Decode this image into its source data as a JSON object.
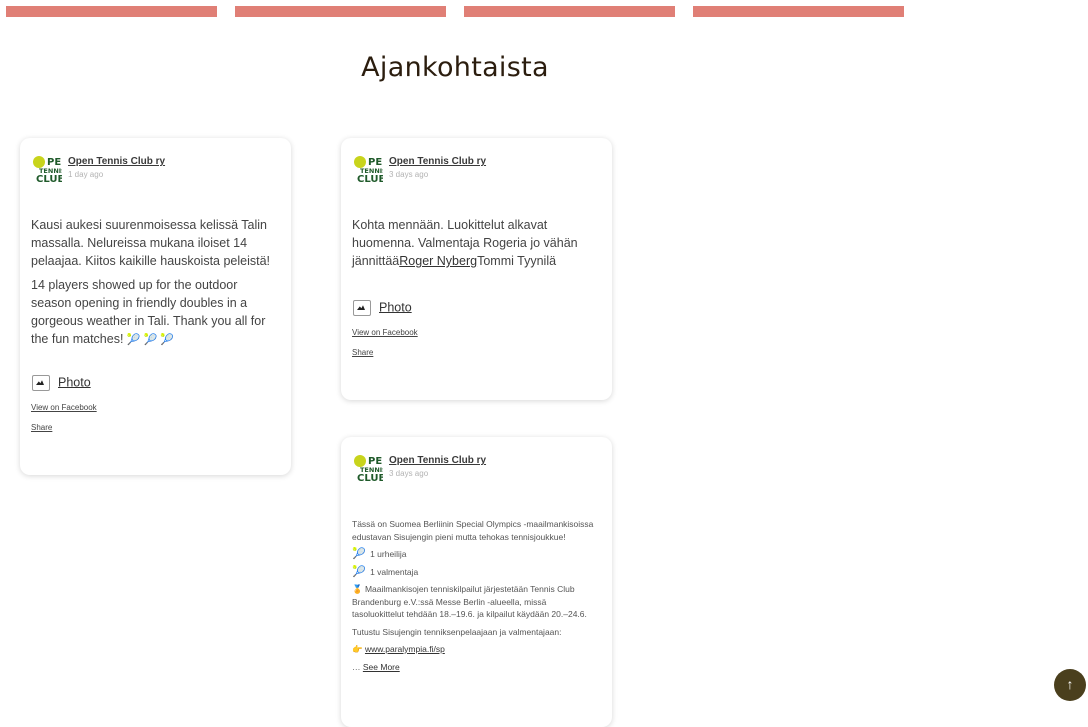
{
  "nav": {
    "items": [
      "",
      "",
      "",
      ""
    ]
  },
  "page": {
    "title": "Ajankohtaista"
  },
  "logo": {
    "alt": "OPEN TENNIS CLUB"
  },
  "posts": [
    {
      "author": "Open Tennis Club ry",
      "time": "1 day ago",
      "paragraphs": [
        "Kausi aukesi suurenmoisessa kelissä Talin massalla. Nelureissa mukana iloiset 14 pelaajaa. Kiitos kaikille hauskoista peleistä!",
        "14 players showed up for the outdoor season opening in friendly doubles in a gorgeous weather in Tali. Thank you all for the fun matches!"
      ],
      "emojis": "🎾 🎾 🎾",
      "photo_label": "Photo",
      "view_label": "View on Facebook",
      "share_label": "Share"
    },
    {
      "author": "Open Tennis Club ry",
      "time": "3 days ago",
      "text_before": "Kohta mennään. Luokittelut alkavat huomenna. Valmentaja Rogeria jo vähän jännittää",
      "mention": "Roger Nyberg",
      "text_after": "Tommi Tyynilä",
      "photo_label": "Photo",
      "view_label": "View on Facebook",
      "share_label": "Share"
    },
    {
      "author": "Open Tennis Club ry",
      "time": "3 days ago",
      "intro": "Tässä on Suomea Berliinin Special Olympics -maailmankisoissa edustavan Sisujengin pieni mutta tehokas tennisjoukkue!",
      "line1": "1 urheilija",
      "line2": "1 valmentaja",
      "venue": "Maailmankisojen tenniskilpailut järjestetään Tennis Club Brandenburg e.V.:ssä Messe Berlin -alueella, missä tasoluokittelut tehdään 18.–19.6. ja kilpailut käydään 20.–24.6.",
      "cta": "Tutustu Sisujengin tenniksenpelaajaan ja valmentajaan:",
      "url": "www.paralympia.fi/sp",
      "see_more": "See More"
    }
  ],
  "scroll_top": {
    "icon": "arrow-up-icon",
    "glyph": "↑"
  }
}
